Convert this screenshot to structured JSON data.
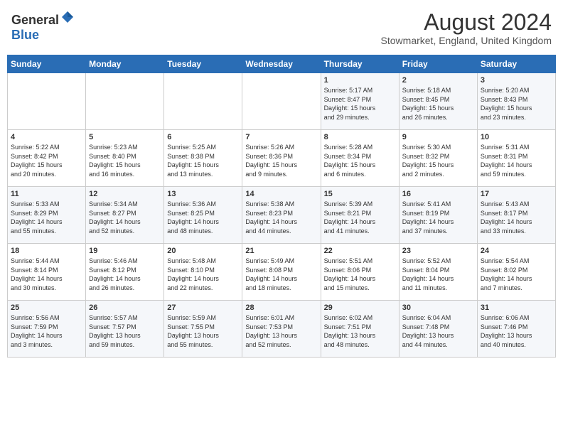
{
  "header": {
    "logo_general": "General",
    "logo_blue": "Blue",
    "month_title": "August 2024",
    "location": "Stowmarket, England, United Kingdom"
  },
  "weekdays": [
    "Sunday",
    "Monday",
    "Tuesday",
    "Wednesday",
    "Thursday",
    "Friday",
    "Saturday"
  ],
  "weeks": [
    [
      {
        "day": "",
        "info": ""
      },
      {
        "day": "",
        "info": ""
      },
      {
        "day": "",
        "info": ""
      },
      {
        "day": "",
        "info": ""
      },
      {
        "day": "1",
        "info": "Sunrise: 5:17 AM\nSunset: 8:47 PM\nDaylight: 15 hours\nand 29 minutes."
      },
      {
        "day": "2",
        "info": "Sunrise: 5:18 AM\nSunset: 8:45 PM\nDaylight: 15 hours\nand 26 minutes."
      },
      {
        "day": "3",
        "info": "Sunrise: 5:20 AM\nSunset: 8:43 PM\nDaylight: 15 hours\nand 23 minutes."
      }
    ],
    [
      {
        "day": "4",
        "info": "Sunrise: 5:22 AM\nSunset: 8:42 PM\nDaylight: 15 hours\nand 20 minutes."
      },
      {
        "day": "5",
        "info": "Sunrise: 5:23 AM\nSunset: 8:40 PM\nDaylight: 15 hours\nand 16 minutes."
      },
      {
        "day": "6",
        "info": "Sunrise: 5:25 AM\nSunset: 8:38 PM\nDaylight: 15 hours\nand 13 minutes."
      },
      {
        "day": "7",
        "info": "Sunrise: 5:26 AM\nSunset: 8:36 PM\nDaylight: 15 hours\nand 9 minutes."
      },
      {
        "day": "8",
        "info": "Sunrise: 5:28 AM\nSunset: 8:34 PM\nDaylight: 15 hours\nand 6 minutes."
      },
      {
        "day": "9",
        "info": "Sunrise: 5:30 AM\nSunset: 8:32 PM\nDaylight: 15 hours\nand 2 minutes."
      },
      {
        "day": "10",
        "info": "Sunrise: 5:31 AM\nSunset: 8:31 PM\nDaylight: 14 hours\nand 59 minutes."
      }
    ],
    [
      {
        "day": "11",
        "info": "Sunrise: 5:33 AM\nSunset: 8:29 PM\nDaylight: 14 hours\nand 55 minutes."
      },
      {
        "day": "12",
        "info": "Sunrise: 5:34 AM\nSunset: 8:27 PM\nDaylight: 14 hours\nand 52 minutes."
      },
      {
        "day": "13",
        "info": "Sunrise: 5:36 AM\nSunset: 8:25 PM\nDaylight: 14 hours\nand 48 minutes."
      },
      {
        "day": "14",
        "info": "Sunrise: 5:38 AM\nSunset: 8:23 PM\nDaylight: 14 hours\nand 44 minutes."
      },
      {
        "day": "15",
        "info": "Sunrise: 5:39 AM\nSunset: 8:21 PM\nDaylight: 14 hours\nand 41 minutes."
      },
      {
        "day": "16",
        "info": "Sunrise: 5:41 AM\nSunset: 8:19 PM\nDaylight: 14 hours\nand 37 minutes."
      },
      {
        "day": "17",
        "info": "Sunrise: 5:43 AM\nSunset: 8:17 PM\nDaylight: 14 hours\nand 33 minutes."
      }
    ],
    [
      {
        "day": "18",
        "info": "Sunrise: 5:44 AM\nSunset: 8:14 PM\nDaylight: 14 hours\nand 30 minutes."
      },
      {
        "day": "19",
        "info": "Sunrise: 5:46 AM\nSunset: 8:12 PM\nDaylight: 14 hours\nand 26 minutes."
      },
      {
        "day": "20",
        "info": "Sunrise: 5:48 AM\nSunset: 8:10 PM\nDaylight: 14 hours\nand 22 minutes."
      },
      {
        "day": "21",
        "info": "Sunrise: 5:49 AM\nSunset: 8:08 PM\nDaylight: 14 hours\nand 18 minutes."
      },
      {
        "day": "22",
        "info": "Sunrise: 5:51 AM\nSunset: 8:06 PM\nDaylight: 14 hours\nand 15 minutes."
      },
      {
        "day": "23",
        "info": "Sunrise: 5:52 AM\nSunset: 8:04 PM\nDaylight: 14 hours\nand 11 minutes."
      },
      {
        "day": "24",
        "info": "Sunrise: 5:54 AM\nSunset: 8:02 PM\nDaylight: 14 hours\nand 7 minutes."
      }
    ],
    [
      {
        "day": "25",
        "info": "Sunrise: 5:56 AM\nSunset: 7:59 PM\nDaylight: 14 hours\nand 3 minutes."
      },
      {
        "day": "26",
        "info": "Sunrise: 5:57 AM\nSunset: 7:57 PM\nDaylight: 13 hours\nand 59 minutes."
      },
      {
        "day": "27",
        "info": "Sunrise: 5:59 AM\nSunset: 7:55 PM\nDaylight: 13 hours\nand 55 minutes."
      },
      {
        "day": "28",
        "info": "Sunrise: 6:01 AM\nSunset: 7:53 PM\nDaylight: 13 hours\nand 52 minutes."
      },
      {
        "day": "29",
        "info": "Sunrise: 6:02 AM\nSunset: 7:51 PM\nDaylight: 13 hours\nand 48 minutes."
      },
      {
        "day": "30",
        "info": "Sunrise: 6:04 AM\nSunset: 7:48 PM\nDaylight: 13 hours\nand 44 minutes."
      },
      {
        "day": "31",
        "info": "Sunrise: 6:06 AM\nSunset: 7:46 PM\nDaylight: 13 hours\nand 40 minutes."
      }
    ]
  ]
}
